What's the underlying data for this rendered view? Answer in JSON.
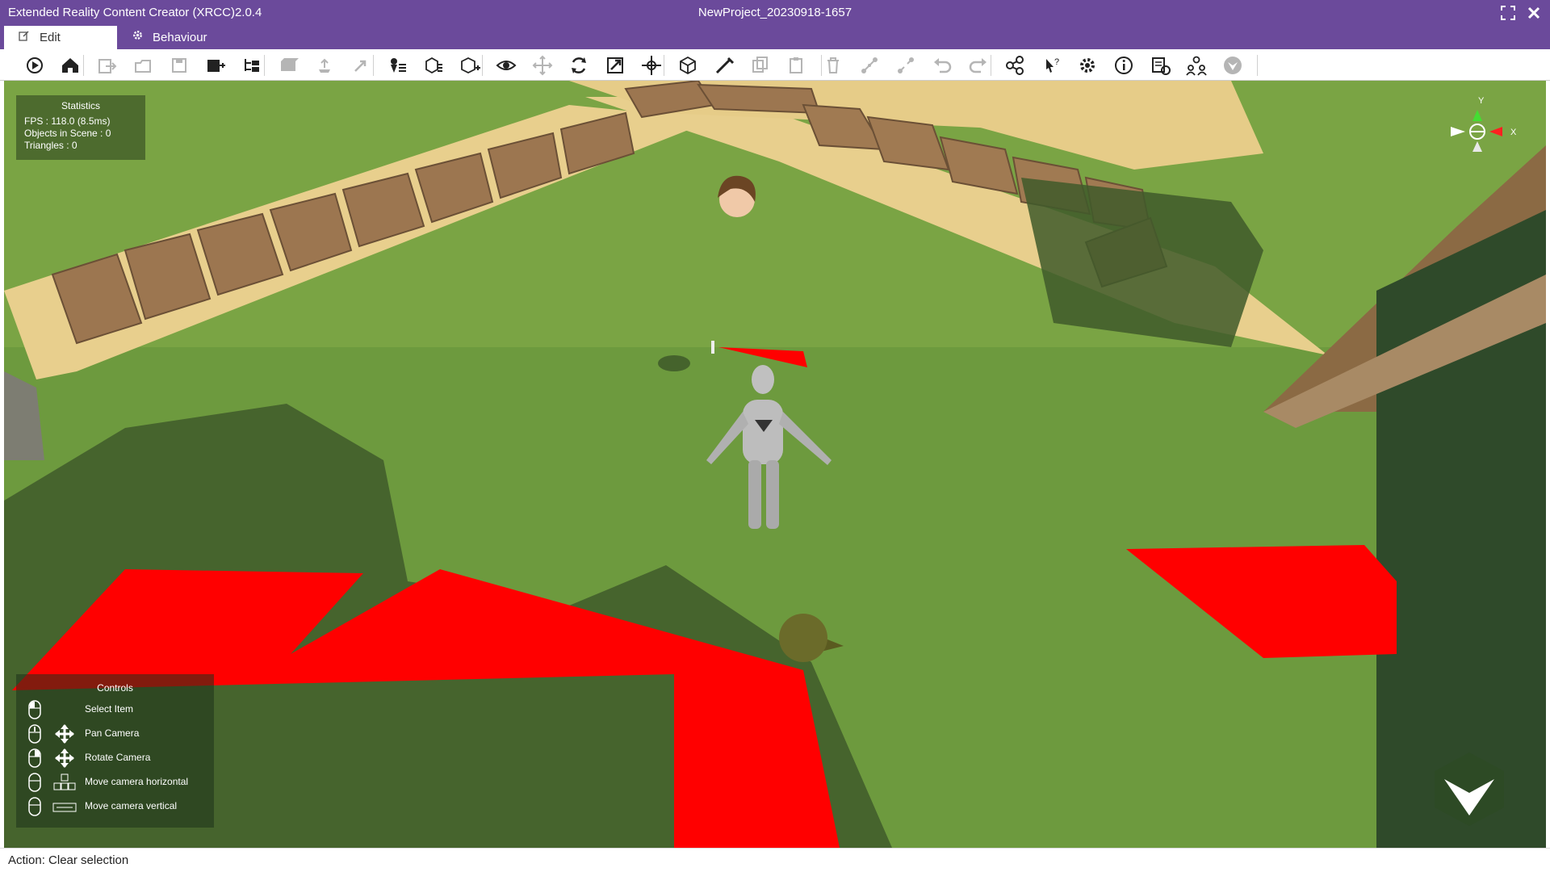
{
  "window": {
    "app_title": "Extended Reality Content Creator (XRCC)2.0.4",
    "project_title": "NewProject_20230918-1657",
    "maximize_icon": "maximize-icon",
    "close_icon": "close-icon"
  },
  "tabs": [
    {
      "label": "Edit",
      "icon": "edit-icon",
      "active": true
    },
    {
      "label": "Behaviour",
      "icon": "gear-icon",
      "active": false
    }
  ],
  "toolbar": {
    "tools": [
      {
        "name": "play",
        "enabled": true
      },
      {
        "name": "home",
        "enabled": true
      },
      {
        "name": "import",
        "enabled": false
      },
      {
        "name": "open",
        "enabled": false
      },
      {
        "name": "save",
        "enabled": false
      },
      {
        "name": "save-as",
        "enabled": true
      },
      {
        "name": "hierarchy",
        "enabled": true
      },
      {
        "name": "objects",
        "enabled": false
      },
      {
        "name": "upload",
        "enabled": false
      },
      {
        "name": "share",
        "enabled": false
      },
      {
        "name": "scene-list",
        "enabled": true
      },
      {
        "name": "cube-list",
        "enabled": true
      },
      {
        "name": "add-cube",
        "enabled": true
      },
      {
        "name": "view",
        "enabled": true
      },
      {
        "name": "move",
        "enabled": false
      },
      {
        "name": "rotate",
        "enabled": true
      },
      {
        "name": "scale",
        "enabled": true
      },
      {
        "name": "pivot",
        "enabled": true
      },
      {
        "name": "bounding-box",
        "enabled": true
      },
      {
        "name": "measure",
        "enabled": true
      },
      {
        "name": "copy",
        "enabled": false
      },
      {
        "name": "paste",
        "enabled": false
      },
      {
        "name": "delete",
        "enabled": false
      },
      {
        "name": "link",
        "enabled": false
      },
      {
        "name": "unlink",
        "enabled": false
      },
      {
        "name": "undo",
        "enabled": false
      },
      {
        "name": "redo",
        "enabled": false
      },
      {
        "name": "network",
        "enabled": true
      },
      {
        "name": "help-cursor",
        "enabled": true
      },
      {
        "name": "settings",
        "enabled": true
      },
      {
        "name": "info",
        "enabled": true
      },
      {
        "name": "report",
        "enabled": true
      },
      {
        "name": "users",
        "enabled": true
      },
      {
        "name": "xr-logo",
        "enabled": false
      }
    ]
  },
  "statistics": {
    "title": "Statistics",
    "fps": "FPS : 118.0 (8.5ms)",
    "objects": "Objects in Scene : 0",
    "triangles": "Triangles : 0"
  },
  "controls": {
    "title": "Controls",
    "items": [
      {
        "label": "Select Item",
        "mouse": "left-click-icon",
        "extra": ""
      },
      {
        "label": "Pan Camera",
        "mouse": "middle-click-icon",
        "extra": "move-arrows-icon"
      },
      {
        "label": "Rotate Camera",
        "mouse": "right-click-icon",
        "extra": "move-arrows-icon"
      },
      {
        "label": "Move camera horizontal",
        "mouse": "mouse-icon",
        "extra": "asd-keys-icon"
      },
      {
        "label": "Move camera vertical",
        "mouse": "mouse-icon",
        "extra": "spacebar-icon"
      }
    ]
  },
  "gizmo": {
    "y_label": "Y",
    "x_label": "X"
  },
  "status": {
    "text": "Action: Clear selection"
  },
  "colors": {
    "titlebar": "#6b4a9b",
    "grass": "#6d9a3e",
    "sand": "#e8cf8d",
    "planks": "#a07a52",
    "red_zone": "#ff0000"
  }
}
